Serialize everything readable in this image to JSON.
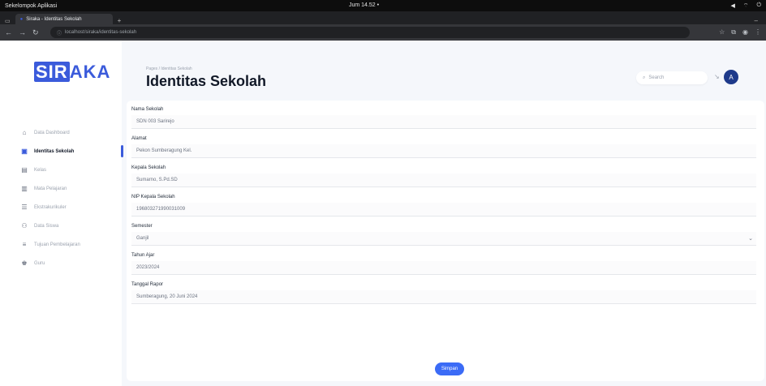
{
  "os_bar": {
    "left_text": "Sekelompok  Aplikasi",
    "center_text": "Jum 14.52  •",
    "right_icons": [
      "volume-icon",
      "network-icon",
      "power-icon"
    ]
  },
  "browser": {
    "tab_title": "Siraka - Identitas Sekolah",
    "url": "localhost/siraka/identitas-sekolah",
    "colors": {
      "chrome_dark": "#202124",
      "chrome_mid": "#35363a"
    }
  },
  "app": {
    "logo": {
      "part1": "SIR",
      "part2": "AKA"
    },
    "sidebar": {
      "items": [
        {
          "icon": "home-icon",
          "label": "Data Dashboard",
          "active": false
        },
        {
          "icon": "school-icon",
          "label": "Identitas Sekolah",
          "active": true
        },
        {
          "icon": "book-icon",
          "label": "Kelas",
          "active": false
        },
        {
          "icon": "file-icon",
          "label": "Mata Pelajaran",
          "active": false
        },
        {
          "icon": "list-icon",
          "label": "Ekstrakurikuler",
          "active": false
        },
        {
          "icon": "users-icon",
          "label": "Data Siswa",
          "active": false
        },
        {
          "icon": "calendar-icon",
          "label": "Tujuan Pembelajaran",
          "active": false
        },
        {
          "icon": "user-icon",
          "label": "Guru",
          "active": false
        }
      ]
    },
    "header": {
      "breadcrumb": "Pages / Identitas Sekolah",
      "title": "Identitas Sekolah",
      "search_placeholder": "Search",
      "avatar_initial": "A"
    },
    "form": {
      "fields": [
        {
          "label": "Nama Sekolah",
          "value": "SDN 003 Sarirejo"
        },
        {
          "label": "Alamat",
          "value": "Pekon Sumberagung Kel."
        },
        {
          "label": "Kepala Sekolah",
          "value": "Sumarno, S.Pd.SD"
        },
        {
          "label": "NIP Kepala Sekolah",
          "value": "196803271990031009"
        },
        {
          "label": "Semester",
          "value": "Ganjil",
          "select": true
        },
        {
          "label": "Tahun Ajar",
          "value": "2023/2024"
        },
        {
          "label": "Tanggal Rapor",
          "value": "Sumberagung, 20 Juni 2024"
        }
      ],
      "save_label": "Simpan"
    },
    "colors": {
      "accent": "#3b5bdb",
      "button": "#3b6bf6",
      "background": "#f5f7fb"
    }
  }
}
